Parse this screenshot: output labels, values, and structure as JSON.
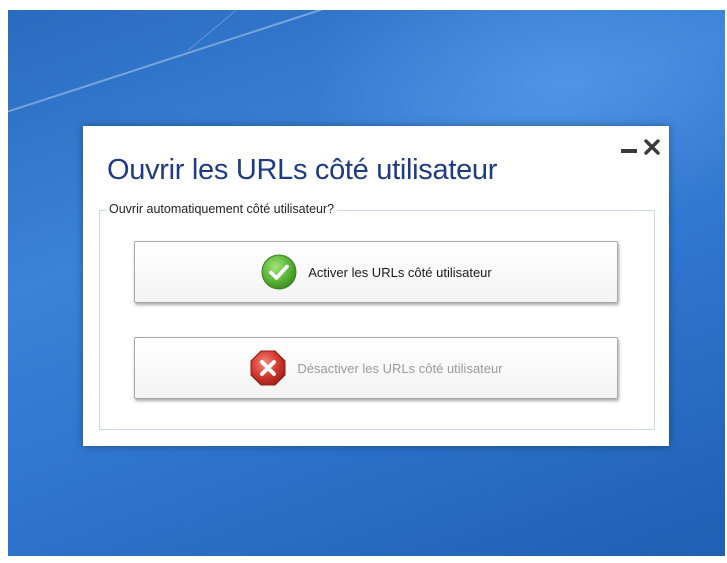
{
  "dialog": {
    "title": "Ouvrir les URLs côté utilisateur",
    "group_label": "Ouvrir automatiquement côté utilisateur?",
    "activate_label": "Activer les URLs côté utilisateur",
    "deactivate_label": "Désactiver les URLs côté utilisateur"
  },
  "icons": {
    "minimize": "minimize-icon",
    "close": "close-icon",
    "activate": "check-circle-icon",
    "deactivate": "x-octagon-icon"
  },
  "colors": {
    "title": "#1e3b85",
    "check_green": "#5cb83a",
    "stop_red": "#d63a2f",
    "desktop_blue": "#2f76cf"
  }
}
